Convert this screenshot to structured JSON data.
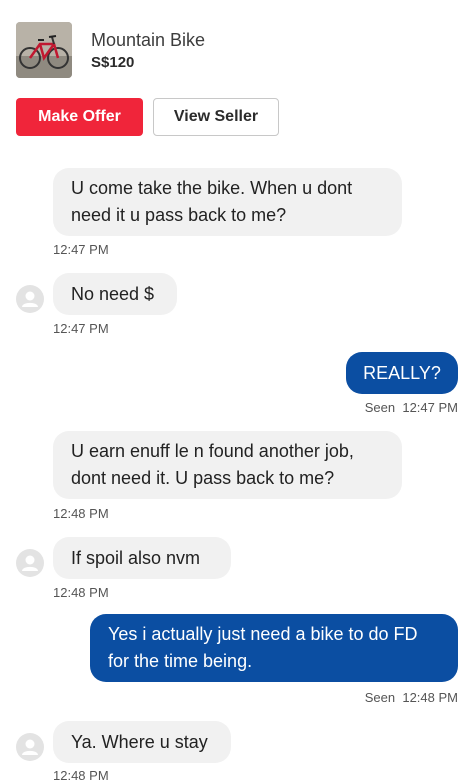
{
  "listing": {
    "title": "Mountain Bike",
    "price": "S$120",
    "thumbnail_icon": "bicycle-photo"
  },
  "actions": {
    "make_offer": "Make Offer",
    "view_seller": "View Seller"
  },
  "colors": {
    "make_offer_bg": "#f0253a",
    "outgoing_bubble_bg": "#0b4ea2",
    "incoming_bubble_bg": "#f1f1f1"
  },
  "messages": [
    {
      "direction": "in",
      "avatar": false,
      "lines": [
        "U come take the bike. When u dont",
        "need it u pass back to me?"
      ],
      "time": "12:47 PM"
    },
    {
      "direction": "in",
      "avatar": true,
      "lines": [
        "No need $"
      ],
      "time": "12:47 PM"
    },
    {
      "direction": "out",
      "lines": [
        "REALLY?"
      ],
      "status": "Seen",
      "time": "12:47 PM"
    },
    {
      "direction": "in",
      "avatar": false,
      "lines": [
        "U earn enuff le n found another job,",
        "dont need it. U pass back to me?"
      ],
      "time": "12:48 PM"
    },
    {
      "direction": "in",
      "avatar": true,
      "lines": [
        "If spoil also nvm"
      ],
      "time": "12:48 PM"
    },
    {
      "direction": "out",
      "lines": [
        "Yes i actually just need a bike to do FD",
        "for the time being."
      ],
      "status": "Seen",
      "time": "12:48 PM"
    },
    {
      "direction": "in",
      "avatar": true,
      "lines": [
        "Ya. Where u stay"
      ],
      "time": "12:48 PM"
    }
  ]
}
